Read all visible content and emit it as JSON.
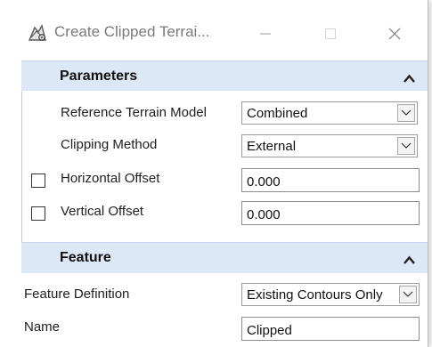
{
  "window": {
    "title": "Create Clipped Terrai...",
    "icon": "clipped-terrain-tool-icon",
    "controls": [
      "minimize-icon",
      "maximize-icon",
      "close-icon"
    ]
  },
  "parameters": {
    "header": "Parameters",
    "reference_terrain_model": {
      "label": "Reference Terrain Model",
      "value": "Combined"
    },
    "clipping_method": {
      "label": "Clipping Method",
      "value": "External"
    },
    "horizontal_offset": {
      "label": "Horizontal Offset",
      "value": "0.000",
      "checked": false
    },
    "vertical_offset": {
      "label": "Vertical Offset",
      "value": "0.000",
      "checked": false
    }
  },
  "feature": {
    "header": "Feature",
    "feature_definition": {
      "label": "Feature Definition",
      "value": "Existing Contours Only"
    },
    "name": {
      "label": "Name",
      "value": "Clipped"
    }
  },
  "colors": {
    "section_header_bg": "#dde8f6",
    "border": "#8d8d8d"
  }
}
